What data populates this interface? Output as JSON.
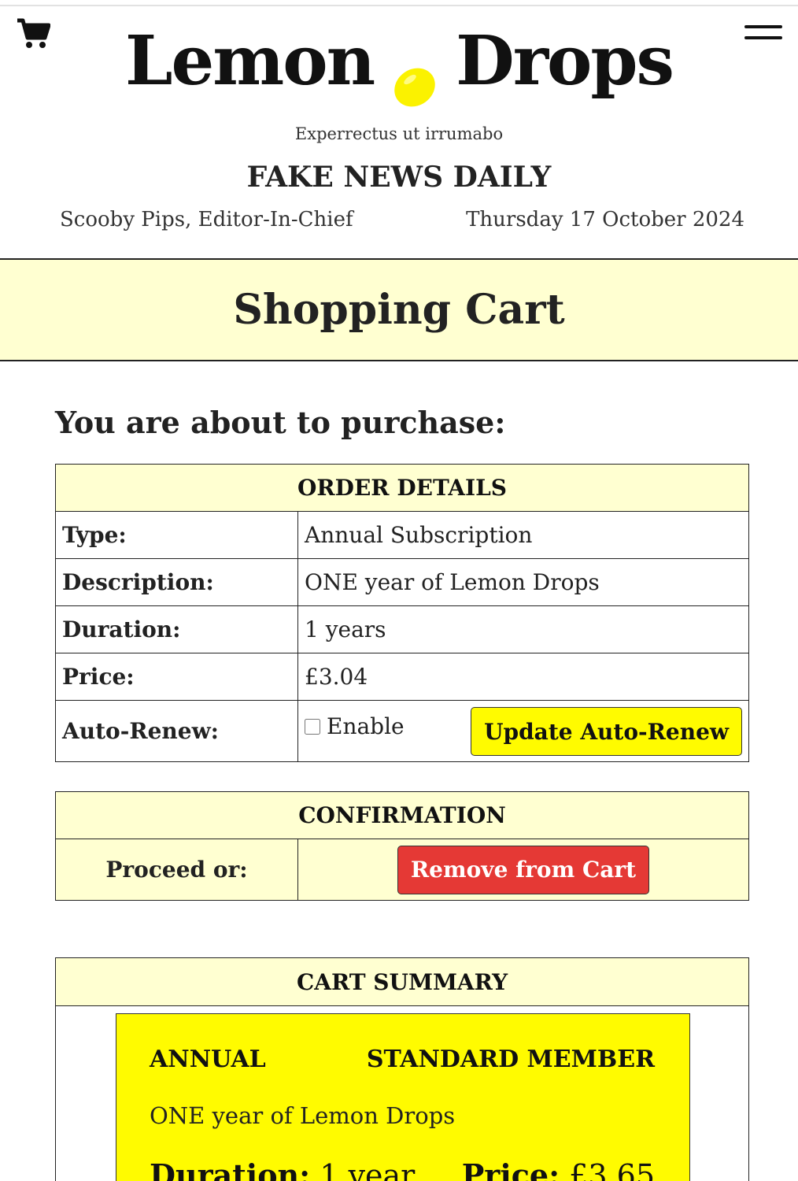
{
  "masthead": {
    "logo_left": "Lemon",
    "logo_right": "Drops",
    "tagline": "Experrectus ut irrumabo",
    "paper_name": "FAKE NEWS DAILY",
    "editor": "Scooby Pips, Editor-In-Chief",
    "date": "Thursday 17 October 2024"
  },
  "icons": {
    "cart": "cart-icon",
    "menu": "hamburger-menu-icon",
    "logo": "lemon-icon"
  },
  "colors": {
    "banner": "#ffffd1",
    "lemon": "#fbf200",
    "button_yellow": "#fffb00",
    "button_red": "#e53935"
  },
  "page": {
    "title": "Shopping Cart",
    "intro": "You are about to purchase:"
  },
  "order": {
    "header": "ORDER DETAILS",
    "rows": [
      {
        "label": "Type:",
        "value": "Annual Subscription"
      },
      {
        "label": "Description:",
        "value": "ONE year of Lemon Drops"
      },
      {
        "label": "Duration:",
        "value": "1 years"
      },
      {
        "label": "Price:",
        "value": "£3.04"
      }
    ],
    "auto_renew_label": "Auto-Renew:",
    "auto_renew_checkbox": "Enable",
    "auto_renew_checked": false,
    "update_button": "Update Auto-Renew"
  },
  "confirmation": {
    "header": "CONFIRMATION",
    "label": "Proceed or:",
    "remove_button": "Remove from Cart"
  },
  "summary": {
    "header": "CART SUMMARY",
    "type": "ANNUAL",
    "member": "STANDARD MEMBER",
    "description": "ONE year of Lemon Drops",
    "duration_label": "Duration:",
    "duration_value": "1 year",
    "price_label": "Price:",
    "price_value": "£3.65"
  }
}
